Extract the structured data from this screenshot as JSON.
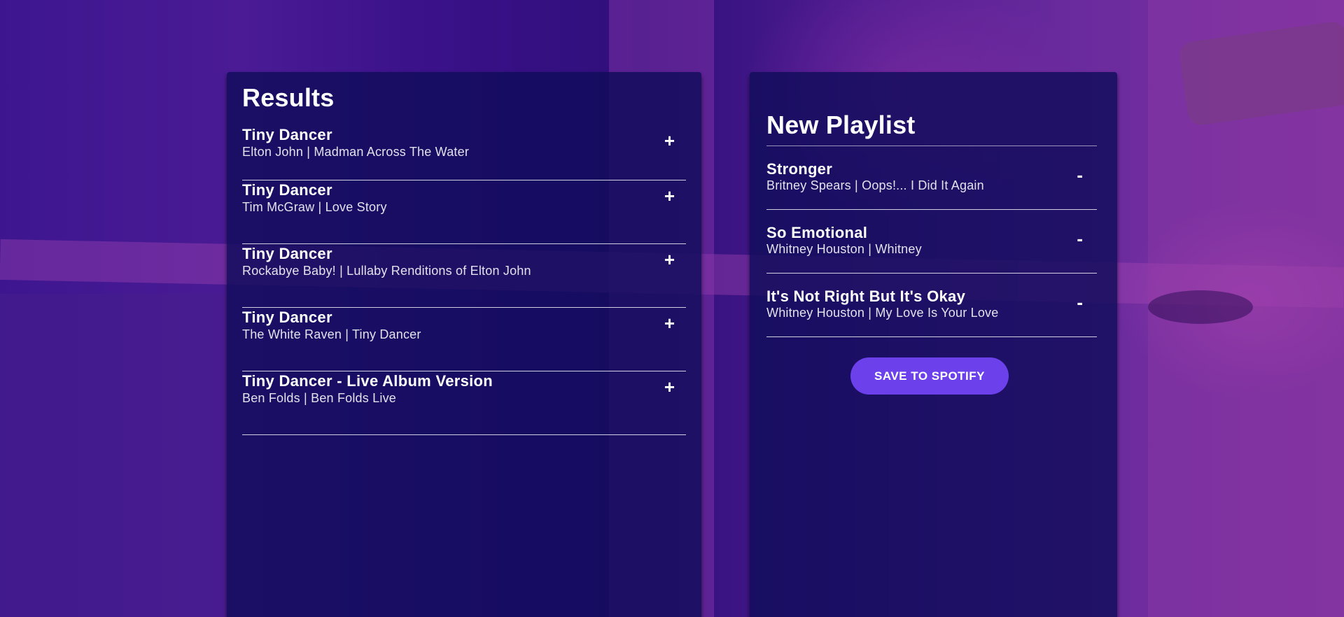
{
  "results": {
    "title": "Results",
    "tracks": [
      {
        "name": "Tiny Dancer",
        "meta": "Elton John | Madman Across The Water",
        "action": "+"
      },
      {
        "name": "Tiny Dancer",
        "meta": "Tim McGraw | Love Story",
        "action": "+"
      },
      {
        "name": "Tiny Dancer",
        "meta": "Rockabye Baby! | Lullaby Renditions of Elton John",
        "action": "+"
      },
      {
        "name": "Tiny Dancer",
        "meta": "The White Raven | Tiny Dancer",
        "action": "+"
      },
      {
        "name": "Tiny Dancer - Live Album Version",
        "meta": "Ben Folds | Ben Folds Live",
        "action": "+"
      }
    ]
  },
  "playlist": {
    "title": "New Playlist",
    "tracks": [
      {
        "name": "Stronger",
        "meta": "Britney Spears | Oops!... I Did It Again",
        "action": "-"
      },
      {
        "name": "So Emotional",
        "meta": "Whitney Houston | Whitney",
        "action": "-"
      },
      {
        "name": "It's Not Right But It's Okay",
        "meta": "Whitney Houston | My Love Is Your Love",
        "action": "-"
      }
    ],
    "save_label": "SAVE TO SPOTIFY"
  },
  "colors": {
    "panel_bg": "#100c5a",
    "accent": "#6c41ec",
    "background": "#3a1390"
  }
}
